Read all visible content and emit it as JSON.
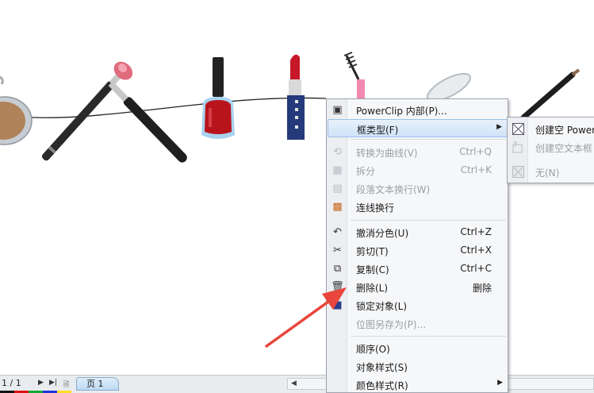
{
  "page_nav": {
    "page_count": "1 / 1",
    "page_tab": "页 1"
  },
  "context_menu": {
    "items": [
      {
        "label": "PowerClip 内部(P)...",
        "shortcut": "",
        "icon": "powerclip-icon"
      },
      {
        "label": "框类型(F)",
        "shortcut": "",
        "icon": "",
        "submenu": true
      },
      {
        "label": "转换为曲线(V)",
        "shortcut": "Ctrl+Q",
        "icon": "convert-curve-icon"
      },
      {
        "label": "拆分",
        "shortcut": "Ctrl+K",
        "icon": "break-apart-icon"
      },
      {
        "label": "段落文本换行(W)",
        "shortcut": "",
        "icon": "paragraph-wrap-icon"
      },
      {
        "label": "连线换行",
        "shortcut": "",
        "icon": "line-wrap-icon"
      },
      {
        "label": "撤消分色(U)",
        "shortcut": "Ctrl+Z",
        "icon": "undo-icon"
      },
      {
        "label": "剪切(T)",
        "shortcut": "Ctrl+X",
        "icon": "cut-icon"
      },
      {
        "label": "复制(C)",
        "shortcut": "Ctrl+C",
        "icon": "copy-icon"
      },
      {
        "label": "删除(L)",
        "shortcut": "删除",
        "icon": "delete-icon"
      },
      {
        "label": "锁定对象(L)",
        "shortcut": "",
        "icon": "lock-icon"
      },
      {
        "label": "位图另存为(P)...",
        "shortcut": "",
        "icon": ""
      },
      {
        "label": "顺序(O)",
        "shortcut": "",
        "icon": ""
      },
      {
        "label": "对象样式(S)",
        "shortcut": "",
        "icon": ""
      },
      {
        "label": "颜色样式(R)",
        "shortcut": "",
        "icon": "",
        "submenu": true
      }
    ]
  },
  "frame_type_submenu": {
    "items": [
      {
        "label": "创建空 Power",
        "icon": "empty-powerclip-icon"
      },
      {
        "label": "创建空文本框",
        "icon": "empty-textframe-icon"
      },
      {
        "label": "无(N)",
        "icon": "none-icon"
      }
    ]
  },
  "colors": {
    "menu_highlight": "#cfe3f7",
    "annotation_arrow": "#e8453c"
  }
}
